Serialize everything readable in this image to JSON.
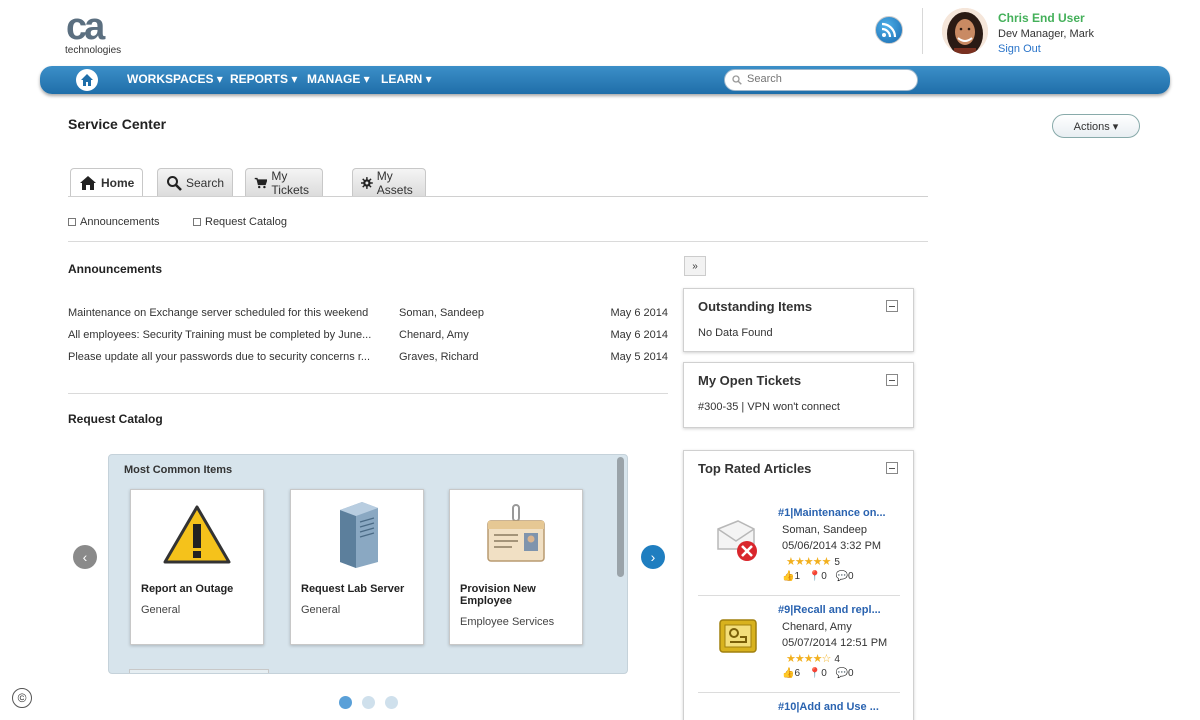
{
  "brand": {
    "logo_text": "ca",
    "logo_sub": "technologies"
  },
  "user": {
    "name": "Chris End User",
    "role": "Dev Manager, Mark",
    "sign_out": "Sign Out"
  },
  "nav": {
    "items": [
      "WORKSPACES ▾",
      "REPORTS ▾",
      "MANAGE ▾",
      "LEARN ▾"
    ],
    "search_placeholder": "Search"
  },
  "page": {
    "title": "Service Center",
    "actions_label": "Actions ▾"
  },
  "tabs": [
    "Home",
    "Search",
    "My Tickets",
    "My Assets"
  ],
  "sublinks": [
    "Announcements",
    "Request Catalog"
  ],
  "announcements": {
    "title": "Announcements",
    "rows": [
      {
        "text": "Maintenance on Exchange server scheduled for this weekend",
        "author": "Soman, Sandeep",
        "date": "May 6 2014"
      },
      {
        "text": "All employees: Security Training must be completed by June...",
        "author": "Chenard, Amy",
        "date": "May 6 2014"
      },
      {
        "text": "Please update all your passwords due to security concerns r...",
        "author": "Graves, Richard",
        "date": "May 5 2014"
      }
    ]
  },
  "catalog": {
    "title": "Request Catalog",
    "group_title": "Most Common Items",
    "items": [
      {
        "title": "Report an Outage",
        "subtitle": "General"
      },
      {
        "title": "Request Lab Server",
        "subtitle": "General"
      },
      {
        "title": "Provision New Employee",
        "subtitle": "Employee Services"
      }
    ]
  },
  "panels": {
    "expand_label": "»",
    "outstanding": {
      "title": "Outstanding Items",
      "body": "No Data Found"
    },
    "open_tickets": {
      "title": "My Open Tickets",
      "ticket": "#300-35 | VPN won't connect"
    },
    "top_articles": {
      "title": "Top Rated Articles",
      "articles": [
        {
          "title": "#1|Maintenance on...",
          "author": "Soman, Sandeep",
          "date": "05/06/2014 3:32 PM",
          "stars": "★★★★★",
          "rating": "5",
          "up": "1",
          "down": "0",
          "comments": "0"
        },
        {
          "title": "#9|Recall and repl...",
          "author": "Chenard, Amy",
          "date": "05/07/2014 12:51 PM",
          "stars": "★★★★☆",
          "rating": "4",
          "up": "6",
          "down": "0",
          "comments": "0"
        },
        {
          "title": "#10|Add and Use ..."
        }
      ]
    }
  },
  "footer": {
    "copyright_symbol": "©"
  },
  "colors": {
    "nav_blue": "#2a7bb8",
    "user_green": "#44b05a",
    "link_blue": "#2a63b0",
    "star_gold": "#f2b01e"
  }
}
